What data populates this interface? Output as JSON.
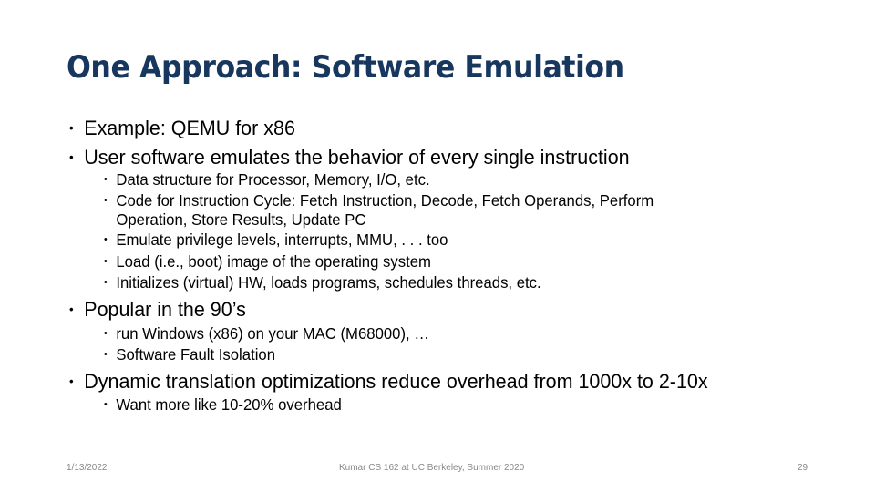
{
  "slide": {
    "title": "One Approach: Software Emulation",
    "bullets": [
      {
        "text": "Example: QEMU for x86"
      },
      {
        "text": "User software emulates the behavior of every single instruction",
        "sub": [
          "Data structure for Processor, Memory, I/O, etc.",
          "Code for Instruction Cycle: Fetch Instruction, Decode, Fetch Operands, Perform",
          "Operation, Store Results, Update PC",
          "Emulate privilege levels, interrupts, MMU, . . . too",
          "Load (i.e., boot) image of the operating system",
          "Initializes (virtual) HW, loads programs, schedules threads, etc."
        ]
      },
      {
        "text": "Popular in the 90’s",
        "sub": [
          "run Windows (x86) on your MAC (M68000), …",
          "Software Fault Isolation"
        ]
      },
      {
        "text": "Dynamic translation optimizations reduce overhead from 1000x to 2-10x",
        "sub": [
          "Want more like 10-20% overhead"
        ]
      }
    ],
    "bullet_glyph": "•",
    "colors": {
      "title": "#17375e",
      "text": "#000000",
      "footer": "#888888"
    }
  },
  "footer": {
    "date": "1/13/2022",
    "center": "Kumar CS 162 at UC Berkeley, Summer 2020",
    "page": "29"
  }
}
